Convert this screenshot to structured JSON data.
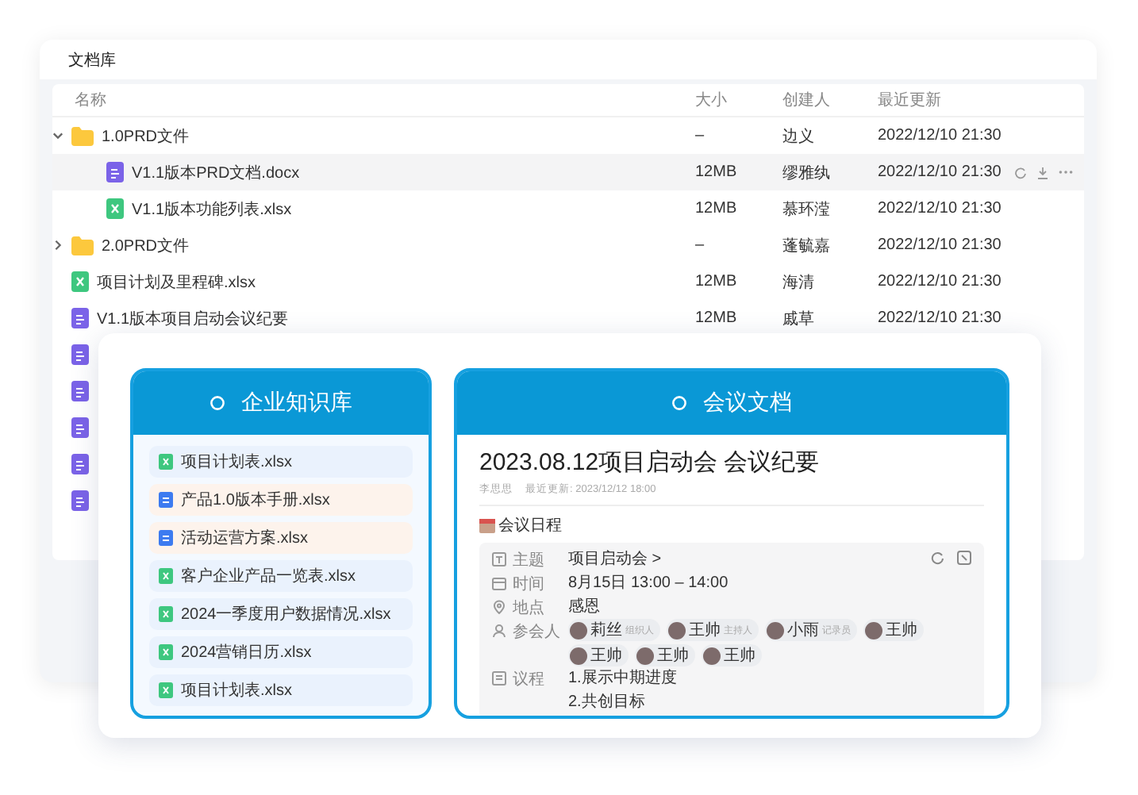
{
  "library": {
    "title": "文档库",
    "columns": [
      "名称",
      "大小",
      "创建人",
      "最近更新"
    ],
    "rows": [
      {
        "kind": "folder",
        "name": "1.0PRD文件",
        "size": "–",
        "creator": "边义",
        "updated": "2022/12/10 21:30",
        "expanded": true,
        "selected": false,
        "children": [
          {
            "kind": "doc",
            "name": "V1.1版本PRD文档.docx",
            "size": "12MB",
            "creator": "缪雅纨",
            "updated": "2022/12/10 21:30",
            "selected": true
          },
          {
            "kind": "sheet",
            "name": "V1.1版本功能列表.xlsx",
            "size": "12MB",
            "creator": "慕环滢",
            "updated": "2022/12/10 21:30",
            "selected": false
          }
        ]
      },
      {
        "kind": "folder",
        "name": "2.0PRD文件",
        "size": "–",
        "creator": "蓬毓嘉",
        "updated": "2022/12/10 21:30",
        "expanded": false,
        "selected": false
      },
      {
        "kind": "sheet",
        "name": "项目计划及里程碑.xlsx",
        "size": "12MB",
        "creator": "海清",
        "updated": "2022/12/10 21:30",
        "selected": false
      },
      {
        "kind": "doc",
        "name": "V1.1版本项目启动会议纪要",
        "size": "12MB",
        "creator": "戚草",
        "updated": "2022/12/10 21:30",
        "selected": false
      },
      {
        "kind": "doc",
        "selected": false
      },
      {
        "kind": "doc",
        "selected": false
      },
      {
        "kind": "doc",
        "selected": false
      },
      {
        "kind": "doc",
        "selected": false
      },
      {
        "kind": "doc",
        "selected": false
      }
    ]
  },
  "knowledge": {
    "title": "企业知识库",
    "items": [
      {
        "kind": "sheet",
        "name": "项目计划表.xlsx"
      },
      {
        "kind": "doc",
        "name": "产品1.0版本手册.xlsx"
      },
      {
        "kind": "doc",
        "name": "活动运营方案.xlsx"
      },
      {
        "kind": "sheet",
        "name": "客户企业产品一览表.xlsx"
      },
      {
        "kind": "sheet",
        "name": "2024一季度用户数据情况.xlsx"
      },
      {
        "kind": "sheet",
        "name": "2024营销日历.xlsx"
      },
      {
        "kind": "sheet",
        "name": "项目计划表.xlsx"
      }
    ]
  },
  "meeting": {
    "panel_title": "会议文档",
    "title": "2023.08.12项目启动会 会议纪要",
    "author": "李思思",
    "updated": "最近更新: 2023/12/12 18:00",
    "section": "会议日程",
    "fields": [
      {
        "kind": "topic",
        "label": "主题",
        "lines": [
          "项目启动会 >"
        ]
      },
      {
        "kind": "time",
        "label": "时间",
        "lines": [
          "8月15日 13:00 – 14:00"
        ]
      },
      {
        "kind": "place",
        "label": "地点",
        "lines": [
          "感恩"
        ]
      },
      {
        "kind": "people",
        "label": "参会人",
        "attendees": [
          {
            "name": "莉丝",
            "role": "组织人"
          },
          {
            "name": "王帅",
            "role": "主持人"
          },
          {
            "name": "小雨",
            "role": "记录员"
          },
          {
            "name": "王帅"
          },
          {
            "name": "王帅"
          },
          {
            "name": "王帅"
          },
          {
            "name": "王帅"
          }
        ]
      },
      {
        "kind": "agenda",
        "label": "议程",
        "lines": [
          "1.展示中期进度",
          "2.共创目标"
        ]
      }
    ]
  }
}
